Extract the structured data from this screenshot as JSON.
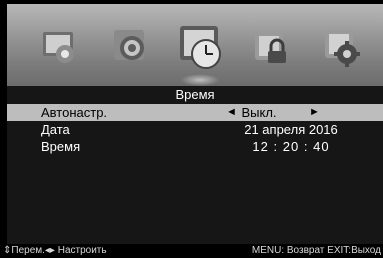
{
  "icons": [
    {
      "name": "picture-icon"
    },
    {
      "name": "sound-icon"
    },
    {
      "name": "time-icon"
    },
    {
      "name": "lock-icon"
    },
    {
      "name": "settings-icon"
    }
  ],
  "menu": {
    "title": "Время",
    "rows": [
      {
        "label": "Автонастр.",
        "value": "Выкл.",
        "left_arrow": "◄",
        "right_arrow": "►"
      },
      {
        "label": "Дата",
        "value": "21 апреля 2016"
      },
      {
        "label": "Время",
        "hours": "12",
        "minutes": "20",
        "seconds": "40",
        "separator": ":"
      }
    ]
  },
  "footer": {
    "nav_hint": "⇕Перем.◂▸ Настроить",
    "action_hint": "MENU: Возврат EXIT:Выход"
  },
  "colors": {
    "icon_bar": "#9a9a9a",
    "background": "#161616",
    "highlight": "#bdbdbd"
  }
}
